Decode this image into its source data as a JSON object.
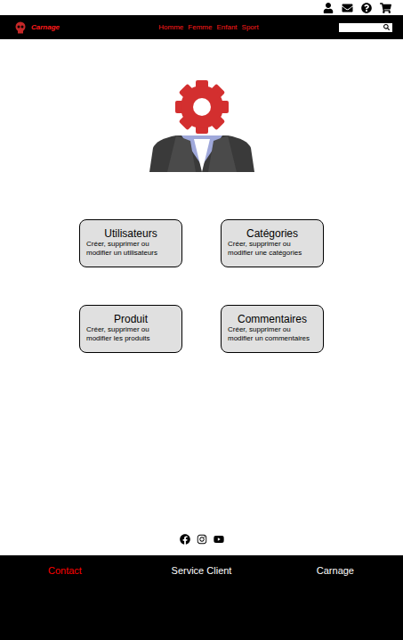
{
  "header": {
    "brand": "Carnage",
    "nav": [
      "Homme",
      "Femme",
      "Enfant",
      "Sport"
    ],
    "search": {
      "placeholder": ""
    }
  },
  "admin_cards": [
    {
      "title": "Utilisateurs",
      "description": "Créer, supprimer ou modifier un utilisateurs"
    },
    {
      "title": "Catégories",
      "description": "Créer, supprimer ou modifier une catégories"
    },
    {
      "title": "Produit",
      "description": "Créer, supprimer ou modifier les produits"
    },
    {
      "title": "Commentaires",
      "description": "Créer, supprimer ou modifier un commentaires"
    }
  ],
  "footer": {
    "links": [
      {
        "label": "Contact",
        "color": "#ff0000"
      },
      {
        "label": "Service Client",
        "color": "#ffffff"
      },
      {
        "label": "Carnage",
        "color": "#ffffff"
      }
    ]
  }
}
